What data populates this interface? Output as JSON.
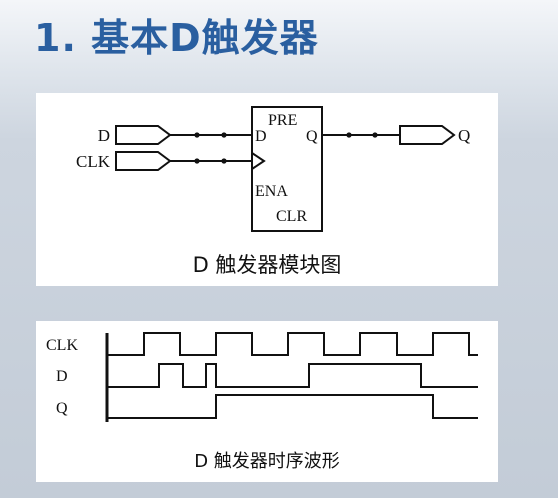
{
  "title": "1.  基本D触发器",
  "block_diagram": {
    "inputs": [
      "D",
      "CLK"
    ],
    "output": "Q",
    "ff_pins": {
      "pre": "PRE",
      "d": "D",
      "q": "Q",
      "ena": "ENA",
      "clr": "CLR"
    },
    "caption": "D 触发器模块图"
  },
  "timing_diagram": {
    "signals": [
      "CLK",
      "D",
      "Q"
    ],
    "caption": "D 触发器时序波形"
  }
}
